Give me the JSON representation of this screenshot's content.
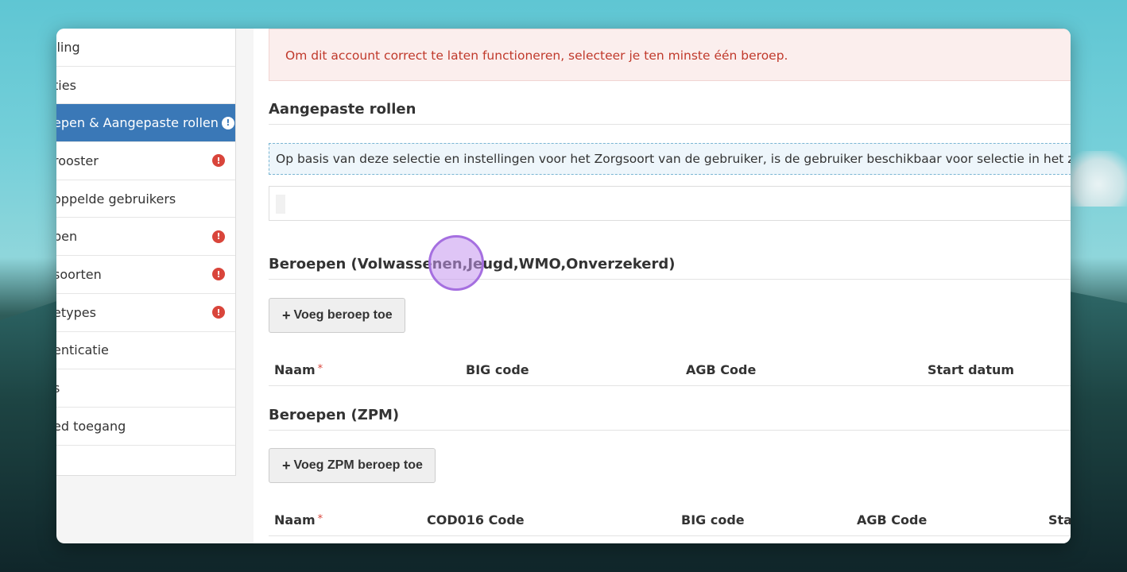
{
  "sidebar": {
    "items": [
      {
        "label": "lling",
        "alert": false,
        "active": false
      },
      {
        "label": "ties",
        "alert": false,
        "active": false
      },
      {
        "label": "epen & Aangepaste rollen",
        "alert": true,
        "active": true
      },
      {
        "label": "rooster",
        "alert": true,
        "active": false
      },
      {
        "label": "oppelde gebruikers",
        "alert": false,
        "active": false
      },
      {
        "label": "pen",
        "alert": true,
        "active": false
      },
      {
        "label": "soorten",
        "alert": true,
        "active": false
      },
      {
        "label": "etypes",
        "alert": true,
        "active": false
      },
      {
        "label": "enticatie",
        "alert": false,
        "active": false
      },
      {
        "label": "s",
        "alert": false,
        "active": false
      },
      {
        "label": "ed toegang",
        "alert": false,
        "active": false
      }
    ],
    "alert_glyph": "!"
  },
  "main": {
    "alert_message": "Om dit account correct te laten functioneren, selecteer je ten minste één beroep.",
    "custom_roles_title": "Aangepaste rollen",
    "custom_roles_info": "Op basis van deze selectie en instellingen voor het Zorgsoort van de gebruiker, is de gebruiker beschikbaar voor selectie in het zorgtype",
    "professions_title": "Beroepen (Volwassenen,Jeugd,WMO,Onverzekerd)",
    "add_profession_label": "Voeg beroep toe",
    "professions_table": {
      "headers": [
        "Naam",
        "BIG code",
        "AGB Code",
        "Start datum"
      ],
      "required_mark": "*"
    },
    "zpm_title": "Beroepen (ZPM)",
    "add_zpm_label": "Voeg ZPM beroep toe",
    "zpm_table": {
      "headers": [
        "Naam",
        "COD016 Code",
        "BIG code",
        "AGB Code",
        "Start"
      ],
      "required_mark": "*"
    },
    "plus_glyph": "+"
  }
}
